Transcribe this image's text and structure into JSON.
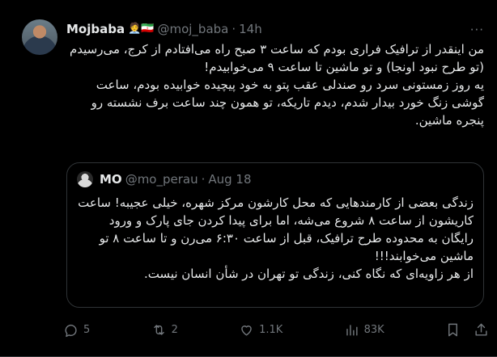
{
  "tweet": {
    "author": {
      "display_name": "Mojbaba",
      "badges": "🧑‍💼🇮🇷",
      "handle": "@moj_baba",
      "separator": "·",
      "time": "14h"
    },
    "more_label": "···",
    "paragraphs": [
      "من اینقدر از ترافیک فراری بودم که ساعت ۳ صبح راه می‌افتادم از کرج، می‌رسیدم (تو طرح نبود اونجا) و تو ماشین تا ساعت ۹ می‌خوابیدم!",
      "یه روز زمستونی سرد رو صندلی عقب پتو به خود پیچیده خوابیده بودم، ساعت گوشی زنگ خورد بیدار شدم، دیدم تاریکه، تو همون چند ساعت برف نشسته رو پنجره ماشین."
    ]
  },
  "quote": {
    "author": {
      "display_name": "MO",
      "handle": "@mo_perau",
      "separator": "·",
      "date": "Aug 18"
    },
    "paragraphs": [
      "زندگی بعضی از کارمندهایی که محل کارشون مرکز شهره، خیلی عجیبه! ساعت کاریشون از ساعت ۸ شروع می‌شه، اما برای پیدا کردن جای پارک و ورود رایگان به محدوده طرح ترافیک، قبل از ساعت ۶:۳۰ می‌رن و تا ساعت ۸ تو ماشین می‌خوابند!!!",
      "از هر زاویه‌ای که نگاه کنی، زندگی تو تهران در شأن انسان نیست."
    ]
  },
  "actions": {
    "replies": "5",
    "reposts": "2",
    "likes": "1.1K",
    "views": "83K"
  },
  "icons": {
    "reply": "reply-icon",
    "repost": "repost-icon",
    "like": "heart-icon",
    "views": "views-icon",
    "bookmark": "bookmark-icon",
    "share": "share-icon"
  },
  "colors": {
    "background": "#000000",
    "text": "#e7e9ea",
    "muted": "#71767b",
    "border": "#2f3336"
  }
}
